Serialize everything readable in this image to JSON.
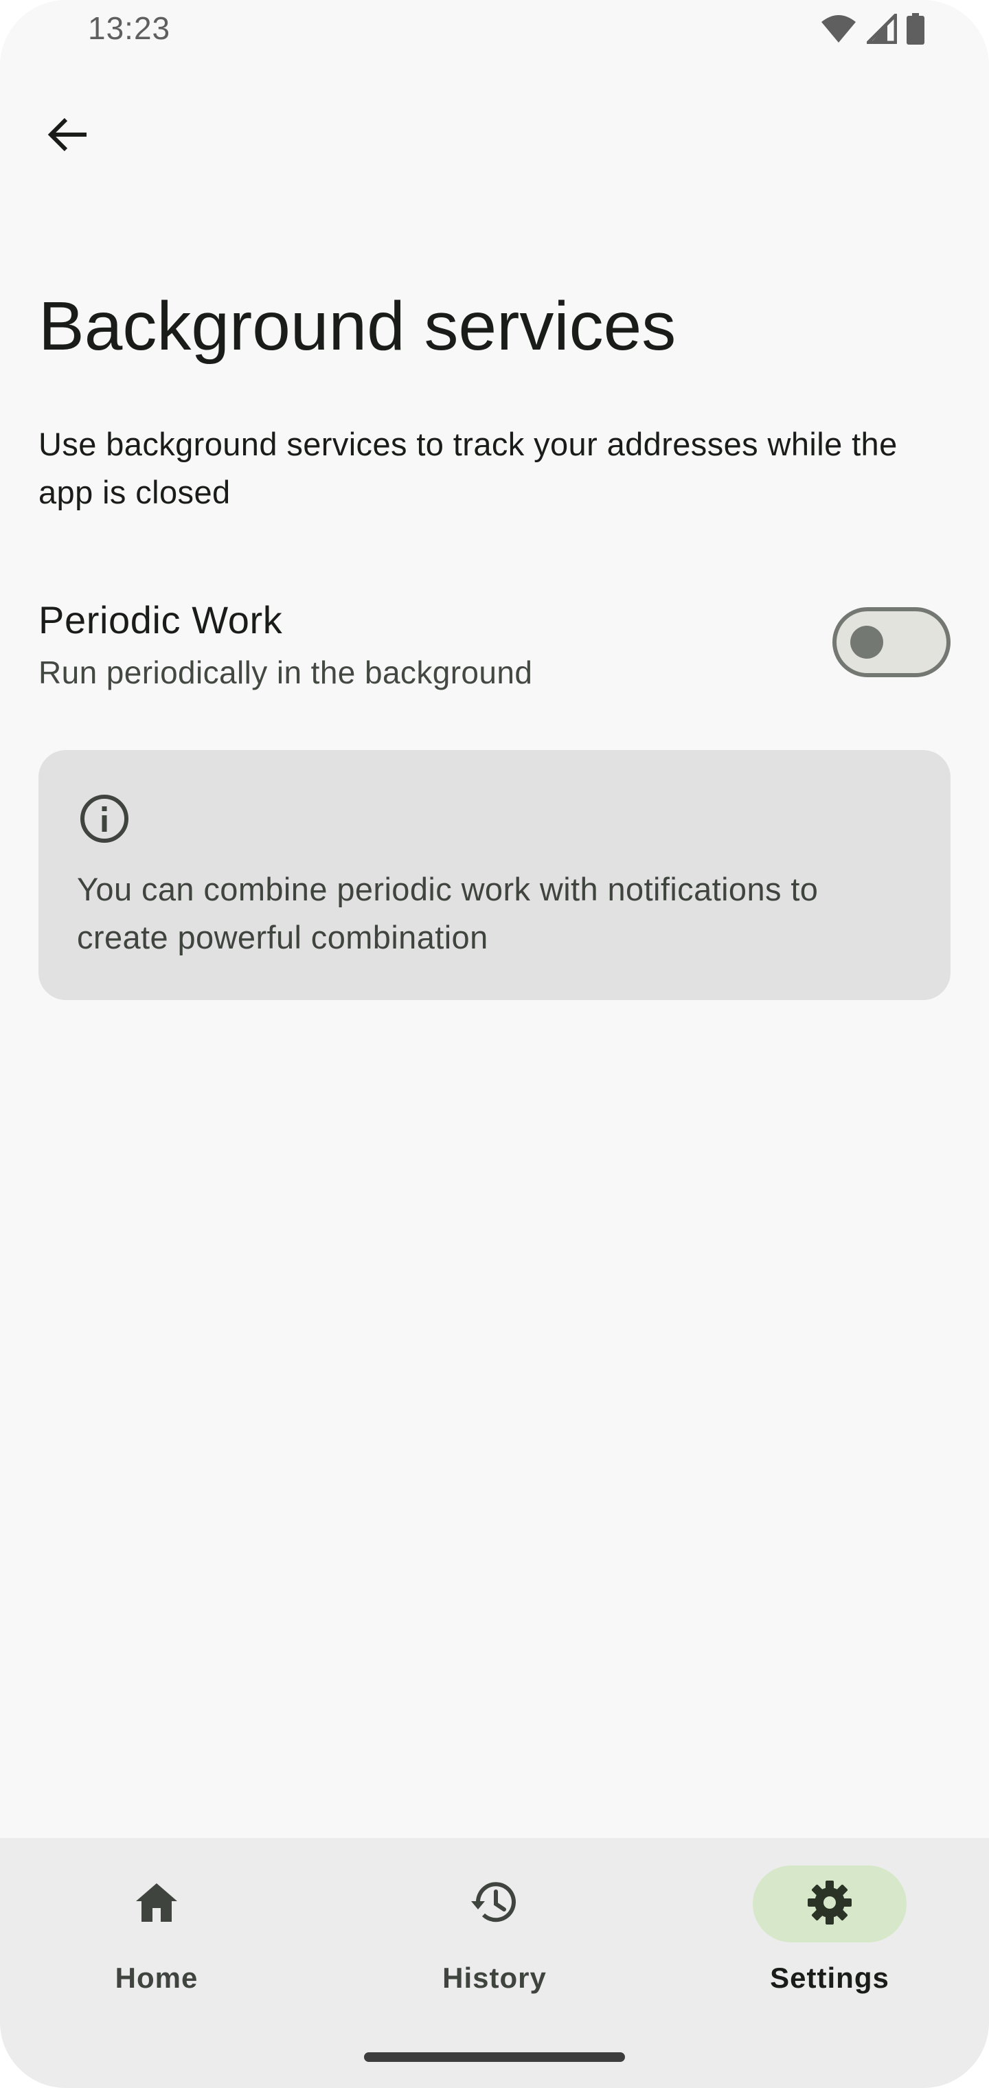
{
  "status_bar": {
    "time": "13:23",
    "icons": [
      "wifi-icon",
      "cell-signal-icon",
      "battery-icon"
    ]
  },
  "top_bar": {
    "back_icon": "arrow-back-icon"
  },
  "page": {
    "title": "Background services",
    "description": "Use background services to track your addresses while the app is closed"
  },
  "periodic_work": {
    "title": "Periodic Work",
    "subtitle": "Run periodically in the background",
    "enabled": false
  },
  "info_card": {
    "icon": "info-icon",
    "text": "You can combine periodic work with notifications to create powerful combination"
  },
  "bottom_nav": {
    "items": [
      {
        "label": "Home",
        "icon": "home-icon",
        "selected": false
      },
      {
        "label": "History",
        "icon": "history-icon",
        "selected": false
      },
      {
        "label": "Settings",
        "icon": "gear-icon",
        "selected": true
      }
    ]
  },
  "colors": {
    "background": "#f8f8f8",
    "nav_background": "#ececec",
    "card_background": "#e1e1e1",
    "selected_indicator": "#d6e8c9",
    "switch_outline": "#737873"
  }
}
